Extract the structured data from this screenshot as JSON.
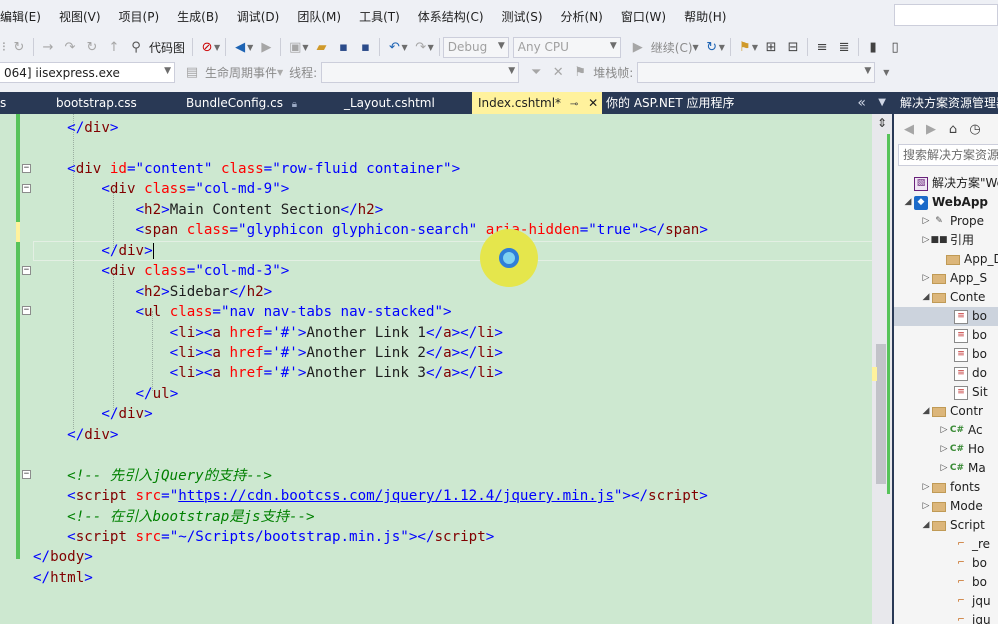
{
  "menu": [
    "编辑(E)",
    "视图(V)",
    "项目(P)",
    "生成(B)",
    "调试(D)",
    "团队(M)",
    "工具(T)",
    "体系结构(C)",
    "测试(S)",
    "分析(N)",
    "窗口(W)",
    "帮助(H)"
  ],
  "toolbar1": {
    "code_map_label": "代码图",
    "config_combo": "Debug",
    "platform_combo": "Any CPU",
    "continue_label": "继续(C)"
  },
  "toolbar2": {
    "process_value": "064] iisexpress.exe",
    "lifecycle_label": "生命周期事件",
    "thread_label": "线程:",
    "stackframe_label": "堆栈帧:"
  },
  "tabs": [
    {
      "label": "s"
    },
    {
      "label": "bootstrap.css"
    },
    {
      "label": "BundleConfig.cs"
    },
    {
      "label": "_Layout.cshtml"
    },
    {
      "label": "Index.cshtml*",
      "active": true
    },
    {
      "label": "你的 ASP.NET 应用程序"
    }
  ],
  "tab_icons": {
    "pin": "pin-icon",
    "close": "close-icon"
  },
  "code_lines": [
    {
      "indent": "    ",
      "parts": [
        [
          "br",
          "</"
        ],
        [
          "tag",
          "div"
        ],
        [
          "br",
          ">"
        ]
      ]
    },
    {
      "indent": "",
      "parts": []
    },
    {
      "indent": "    ",
      "parts": [
        [
          "br",
          "<"
        ],
        [
          "tag",
          "div"
        ],
        [
          "txt",
          " "
        ],
        [
          "attr",
          "id"
        ],
        [
          "br",
          "="
        ],
        [
          "val",
          "\"content\""
        ],
        [
          "txt",
          " "
        ],
        [
          "attr",
          "class"
        ],
        [
          "br",
          "="
        ],
        [
          "val",
          "\"row-fluid container\""
        ],
        [
          "br",
          ">"
        ]
      ]
    },
    {
      "indent": "        ",
      "parts": [
        [
          "br",
          "<"
        ],
        [
          "tag",
          "div"
        ],
        [
          "txt",
          " "
        ],
        [
          "attr",
          "class"
        ],
        [
          "br",
          "="
        ],
        [
          "val",
          "\"col-md-9\""
        ],
        [
          "br",
          ">"
        ]
      ]
    },
    {
      "indent": "            ",
      "parts": [
        [
          "br",
          "<"
        ],
        [
          "tag",
          "h2"
        ],
        [
          "br",
          ">"
        ],
        [
          "txt",
          "Main Content Section"
        ],
        [
          "br",
          "</"
        ],
        [
          "tag",
          "h2"
        ],
        [
          "br",
          ">"
        ]
      ]
    },
    {
      "indent": "            ",
      "parts": [
        [
          "br",
          "<"
        ],
        [
          "tag",
          "span"
        ],
        [
          "txt",
          " "
        ],
        [
          "attr",
          "class"
        ],
        [
          "br",
          "="
        ],
        [
          "val",
          "\"glyphicon glyphicon-search\""
        ],
        [
          "txt",
          " "
        ],
        [
          "attr",
          "aria-hidden"
        ],
        [
          "br",
          "="
        ],
        [
          "val",
          "\"true\""
        ],
        [
          "br",
          "></"
        ],
        [
          "tag",
          "span"
        ],
        [
          "br",
          ">"
        ]
      ]
    },
    {
      "indent": "        ",
      "parts": [
        [
          "br",
          "</"
        ],
        [
          "tag",
          "div"
        ],
        [
          "br",
          ">"
        ],
        [
          "caret",
          ""
        ]
      ]
    },
    {
      "indent": "        ",
      "parts": [
        [
          "br",
          "<"
        ],
        [
          "tag",
          "div"
        ],
        [
          "txt",
          " "
        ],
        [
          "attr",
          "class"
        ],
        [
          "br",
          "="
        ],
        [
          "val",
          "\"col-md-3\""
        ],
        [
          "br",
          ">"
        ]
      ]
    },
    {
      "indent": "            ",
      "parts": [
        [
          "br",
          "<"
        ],
        [
          "tag",
          "h2"
        ],
        [
          "br",
          ">"
        ],
        [
          "txt",
          "Sidebar"
        ],
        [
          "br",
          "</"
        ],
        [
          "tag",
          "h2"
        ],
        [
          "br",
          ">"
        ]
      ]
    },
    {
      "indent": "            ",
      "parts": [
        [
          "br",
          "<"
        ],
        [
          "tag",
          "ul"
        ],
        [
          "txt",
          " "
        ],
        [
          "attr",
          "class"
        ],
        [
          "br",
          "="
        ],
        [
          "val",
          "\"nav nav-tabs nav-stacked\""
        ],
        [
          "br",
          ">"
        ]
      ]
    },
    {
      "indent": "                ",
      "parts": [
        [
          "br",
          "<"
        ],
        [
          "tag",
          "li"
        ],
        [
          "br",
          "><"
        ],
        [
          "tag",
          "a"
        ],
        [
          "txt",
          " "
        ],
        [
          "attr",
          "href"
        ],
        [
          "br",
          "="
        ],
        [
          "val",
          "'#'"
        ],
        [
          "br",
          ">"
        ],
        [
          "txt",
          "Another Link 1"
        ],
        [
          "br",
          "</"
        ],
        [
          "tag",
          "a"
        ],
        [
          "br",
          "></"
        ],
        [
          "tag",
          "li"
        ],
        [
          "br",
          ">"
        ]
      ]
    },
    {
      "indent": "                ",
      "parts": [
        [
          "br",
          "<"
        ],
        [
          "tag",
          "li"
        ],
        [
          "br",
          "><"
        ],
        [
          "tag",
          "a"
        ],
        [
          "txt",
          " "
        ],
        [
          "attr",
          "href"
        ],
        [
          "br",
          "="
        ],
        [
          "val",
          "'#'"
        ],
        [
          "br",
          ">"
        ],
        [
          "txt",
          "Another Link 2"
        ],
        [
          "br",
          "</"
        ],
        [
          "tag",
          "a"
        ],
        [
          "br",
          "></"
        ],
        [
          "tag",
          "li"
        ],
        [
          "br",
          ">"
        ]
      ]
    },
    {
      "indent": "                ",
      "parts": [
        [
          "br",
          "<"
        ],
        [
          "tag",
          "li"
        ],
        [
          "br",
          "><"
        ],
        [
          "tag",
          "a"
        ],
        [
          "txt",
          " "
        ],
        [
          "attr",
          "href"
        ],
        [
          "br",
          "="
        ],
        [
          "val",
          "'#'"
        ],
        [
          "br",
          ">"
        ],
        [
          "txt",
          "Another Link 3"
        ],
        [
          "br",
          "</"
        ],
        [
          "tag",
          "a"
        ],
        [
          "br",
          "></"
        ],
        [
          "tag",
          "li"
        ],
        [
          "br",
          ">"
        ]
      ]
    },
    {
      "indent": "            ",
      "parts": [
        [
          "br",
          "</"
        ],
        [
          "tag",
          "ul"
        ],
        [
          "br",
          ">"
        ]
      ]
    },
    {
      "indent": "        ",
      "parts": [
        [
          "br",
          "</"
        ],
        [
          "tag",
          "div"
        ],
        [
          "br",
          ">"
        ]
      ]
    },
    {
      "indent": "    ",
      "parts": [
        [
          "br",
          "</"
        ],
        [
          "tag",
          "div"
        ],
        [
          "br",
          ">"
        ]
      ]
    },
    {
      "indent": "",
      "parts": []
    },
    {
      "indent": "    ",
      "parts": [
        [
          "cmt",
          "<!-- 先引入jQuery的支持-->"
        ]
      ]
    },
    {
      "indent": "    ",
      "parts": [
        [
          "br",
          "<"
        ],
        [
          "tag",
          "script"
        ],
        [
          "txt",
          " "
        ],
        [
          "attr",
          "src"
        ],
        [
          "br",
          "="
        ],
        [
          "val",
          "\""
        ],
        [
          "link",
          "https://cdn.bootcss.com/jquery/1.12.4/jquery.min.js"
        ],
        [
          "val",
          "\""
        ],
        [
          "br",
          "></"
        ],
        [
          "tag",
          "script"
        ],
        [
          "br",
          ">"
        ]
      ]
    },
    {
      "indent": "    ",
      "parts": [
        [
          "cmt",
          "<!-- 在引入bootstrap是js支持-->"
        ]
      ]
    },
    {
      "indent": "    ",
      "parts": [
        [
          "br",
          "<"
        ],
        [
          "tag",
          "script"
        ],
        [
          "txt",
          " "
        ],
        [
          "attr",
          "src"
        ],
        [
          "br",
          "="
        ],
        [
          "val",
          "\"~/Scripts/bootstrap.min.js\""
        ],
        [
          "br",
          "></"
        ],
        [
          "tag",
          "script"
        ],
        [
          "br",
          ">"
        ]
      ]
    },
    {
      "indent": "",
      "parts": [
        [
          "br",
          "</"
        ],
        [
          "tag",
          "body"
        ],
        [
          "br",
          ">"
        ]
      ]
    },
    {
      "indent": "",
      "parts": [
        [
          "br",
          "</"
        ],
        [
          "tag",
          "html"
        ],
        [
          "br",
          ">"
        ]
      ]
    }
  ],
  "solution_explorer": {
    "title": "解决方案资源管理器",
    "search_placeholder": "搜索解决方案资源管理器",
    "items": [
      {
        "label": "解决方案\"We",
        "icon": "solution-icon"
      },
      {
        "label": "WebApp",
        "icon": "project-icon",
        "bold": true
      },
      {
        "label": "Prope",
        "icon": "wrench-icon"
      },
      {
        "label": "引用",
        "icon": "reference-icon"
      },
      {
        "label": "App_D",
        "icon": "folder-icon"
      },
      {
        "label": "App_S",
        "icon": "folder-icon"
      },
      {
        "label": "Conte",
        "icon": "folder-icon"
      },
      {
        "label": "bo",
        "icon": "css-file-icon",
        "selected": true
      },
      {
        "label": "bo",
        "icon": "css-file-icon"
      },
      {
        "label": "bo",
        "icon": "css-file-icon"
      },
      {
        "label": "do",
        "icon": "css-file-icon"
      },
      {
        "label": "Sit",
        "icon": "css-file-icon"
      },
      {
        "label": "Contr",
        "icon": "folder-icon"
      },
      {
        "label": "Ac",
        "icon": "csharp-file-icon"
      },
      {
        "label": "Ho",
        "icon": "csharp-file-icon"
      },
      {
        "label": "Ma",
        "icon": "csharp-file-icon"
      },
      {
        "label": "fonts",
        "icon": "folder-icon"
      },
      {
        "label": "Mode",
        "icon": "folder-icon"
      },
      {
        "label": "Script",
        "icon": "folder-icon"
      },
      {
        "label": "_re",
        "icon": "js-file-icon"
      },
      {
        "label": "bo",
        "icon": "js-file-icon"
      },
      {
        "label": "bo",
        "icon": "js-file-icon"
      },
      {
        "label": "jqu",
        "icon": "js-file-icon"
      },
      {
        "label": "jqu",
        "icon": "js-file-icon"
      }
    ]
  }
}
